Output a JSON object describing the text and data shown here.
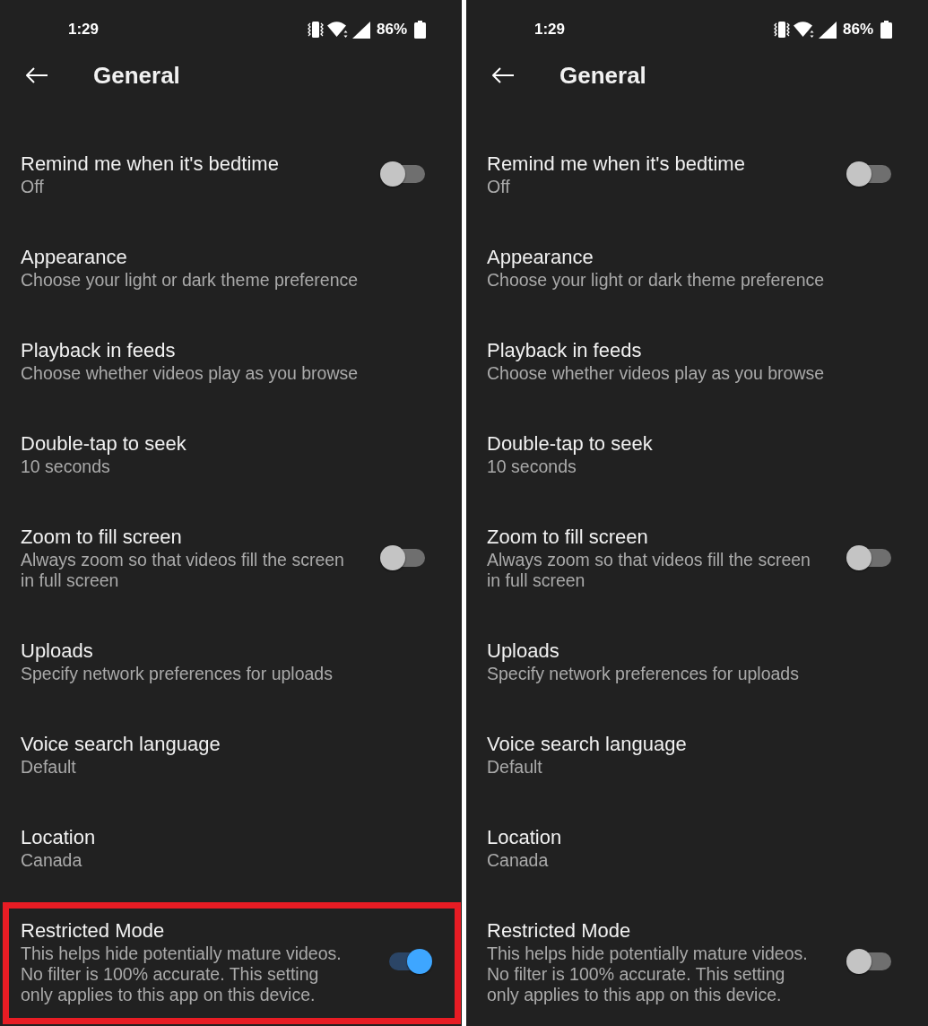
{
  "panels": [
    {
      "status_bar": {
        "time": "1:29",
        "battery": "86%"
      },
      "header": {
        "title": "General"
      },
      "settings": [
        {
          "kind": "toggle",
          "title": "Remind me when it's bedtime",
          "subtitle": "Off",
          "on": false,
          "highlighted": false
        },
        {
          "kind": "link",
          "title": "Appearance",
          "subtitle": "Choose your light or dark theme preference",
          "highlighted": false
        },
        {
          "kind": "link",
          "title": "Playback in feeds",
          "subtitle": "Choose whether videos play as you browse",
          "highlighted": false
        },
        {
          "kind": "link",
          "title": "Double-tap to seek",
          "subtitle": "10 seconds",
          "highlighted": false
        },
        {
          "kind": "toggle",
          "title": "Zoom to fill screen",
          "subtitle": "Always zoom so that videos fill the screen in full screen",
          "on": false,
          "highlighted": false
        },
        {
          "kind": "link",
          "title": "Uploads",
          "subtitle": "Specify network preferences for uploads",
          "highlighted": false
        },
        {
          "kind": "link",
          "title": "Voice search language",
          "subtitle": "Default",
          "highlighted": false
        },
        {
          "kind": "link",
          "title": "Location",
          "subtitle": "Canada",
          "highlighted": false
        },
        {
          "kind": "toggle",
          "title": "Restricted Mode",
          "subtitle": "This helps hide potentially mature videos. No filter is 100% accurate. This setting only applies to this app on this device.",
          "on": true,
          "highlighted": true
        }
      ]
    },
    {
      "status_bar": {
        "time": "1:29",
        "battery": "86%"
      },
      "header": {
        "title": "General"
      },
      "settings": [
        {
          "kind": "toggle",
          "title": "Remind me when it's bedtime",
          "subtitle": "Off",
          "on": false,
          "highlighted": false
        },
        {
          "kind": "link",
          "title": "Appearance",
          "subtitle": "Choose your light or dark theme preference",
          "highlighted": false
        },
        {
          "kind": "link",
          "title": "Playback in feeds",
          "subtitle": "Choose whether videos play as you browse",
          "highlighted": false
        },
        {
          "kind": "link",
          "title": "Double-tap to seek",
          "subtitle": "10 seconds",
          "highlighted": false
        },
        {
          "kind": "toggle",
          "title": "Zoom to fill screen",
          "subtitle": "Always zoom so that videos fill the screen in full screen",
          "on": false,
          "highlighted": false
        },
        {
          "kind": "link",
          "title": "Uploads",
          "subtitle": "Specify network preferences for uploads",
          "highlighted": false
        },
        {
          "kind": "link",
          "title": "Voice search language",
          "subtitle": "Default",
          "highlighted": false
        },
        {
          "kind": "link",
          "title": "Location",
          "subtitle": "Canada",
          "highlighted": false
        },
        {
          "kind": "toggle",
          "title": "Restricted Mode",
          "subtitle": "This helps hide potentially mature videos. No filter is 100% accurate. This setting only applies to this app on this device.",
          "on": false,
          "highlighted": false
        }
      ]
    }
  ]
}
